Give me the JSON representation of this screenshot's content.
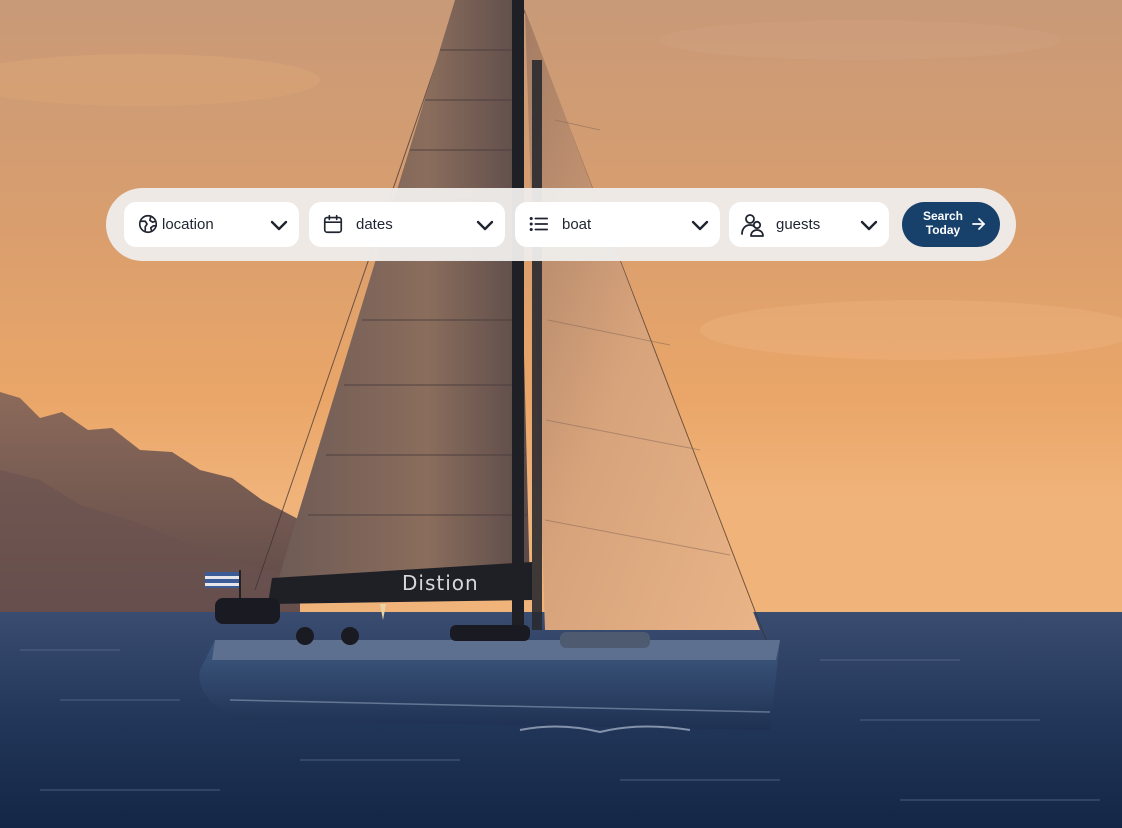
{
  "hero": {
    "boat_sail_text": "Distion"
  },
  "search": {
    "fields": [
      {
        "label": "location",
        "icon": "globe-icon"
      },
      {
        "label": "dates",
        "icon": "calendar-icon"
      },
      {
        "label": "boat",
        "icon": "list-icon"
      },
      {
        "label": "guests",
        "icon": "users-icon"
      }
    ],
    "button": {
      "label": "Search\nToday",
      "icon": "arrow-right-icon",
      "color": "#17416b"
    }
  }
}
